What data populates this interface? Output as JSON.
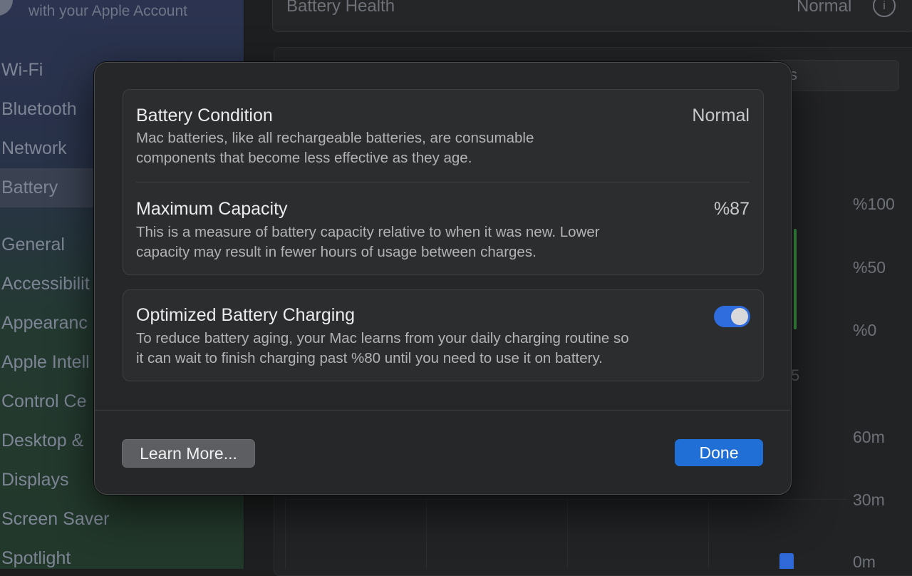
{
  "background": {
    "sidebar": {
      "account_text": "with your Apple Account",
      "items": [
        {
          "label": "Wi-Fi"
        },
        {
          "label": "Bluetooth"
        },
        {
          "label": "Network"
        },
        {
          "label": "Battery"
        },
        {
          "label": "General"
        },
        {
          "label": "Accessibilit"
        },
        {
          "label": "Appearanc"
        },
        {
          "label": "Apple Intell"
        },
        {
          "label": "Control Ce"
        },
        {
          "label": "Desktop &"
        },
        {
          "label": "Displays"
        },
        {
          "label": "Screen Saver"
        },
        {
          "label": "Spotlight"
        }
      ]
    },
    "main": {
      "health_label": "Battery Health",
      "health_value": "Normal",
      "info_glyph": "i",
      "segment_fragment": "s",
      "fragment_5": "5",
      "battery_axis": [
        "%100",
        "%50",
        "%0"
      ],
      "usage_axis": [
        "60m",
        "30m",
        "0m"
      ]
    }
  },
  "modal": {
    "battery_condition": {
      "title": "Battery Condition",
      "value": "Normal",
      "description_line1": "Mac batteries, like all rechargeable batteries, are consumable",
      "description_line2": "components that become less effective as they age."
    },
    "maximum_capacity": {
      "title": "Maximum Capacity",
      "value": "%87",
      "description_line1": "This is a measure of battery capacity relative to when it was new. Lower",
      "description_line2": "capacity may result in fewer hours of usage between charges."
    },
    "optimized_charging": {
      "title": "Optimized Battery Charging",
      "enabled": true,
      "description_line1": "To reduce battery aging, your Mac learns from your daily charging routine so",
      "description_line2": "it can wait to finish charging past %80 until you need to use it on battery."
    },
    "learn_more_label": "Learn More...",
    "done_label": "Done"
  },
  "colors": {
    "accent": "#1f6fd6",
    "toggle_on": "#2f6dde",
    "chart_bar": "#3f9b45"
  }
}
